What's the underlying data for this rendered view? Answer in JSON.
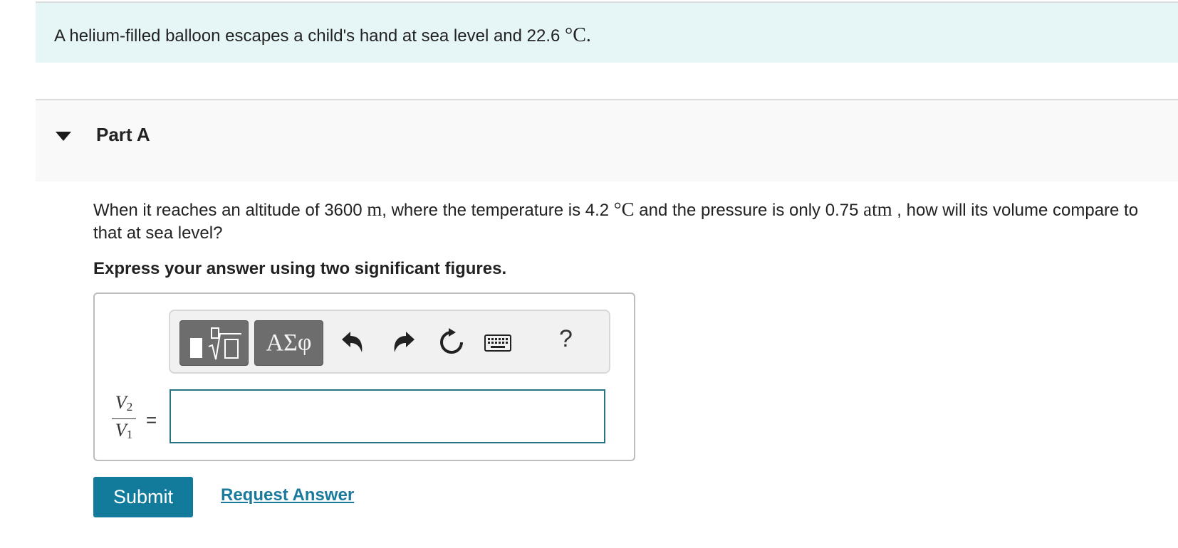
{
  "intro": {
    "text": "A helium-filled balloon escapes a child's hand at sea level and 22.6 ",
    "unit": "°C",
    "end": "."
  },
  "part": {
    "title": "Part A",
    "expanded": true
  },
  "question": {
    "t1": "When it reaches an altitude of 3600 ",
    "u1": "m",
    "t2": ", where the temperature is 4.2 ",
    "u2": "°C",
    "t3": " and the pressure is only 0.75 ",
    "u3": "atm",
    "t4": " , how will its volume compare to that at sea level?"
  },
  "instruction": "Express your answer using two significant figures.",
  "toolbar": {
    "templates_icon": "templates-icon",
    "greek_label": "ΑΣφ",
    "undo_icon": "undo-icon",
    "redo_icon": "redo-icon",
    "reset_icon": "reset-icon",
    "keyboard_icon": "keyboard-icon",
    "help_label": "?"
  },
  "answer": {
    "numerator_var": "V",
    "numerator_sub": "2",
    "denominator_var": "V",
    "denominator_sub": "1",
    "equals": "=",
    "value": ""
  },
  "buttons": {
    "submit": "Submit",
    "request_answer": "Request Answer"
  },
  "colors": {
    "intro_bg": "#e6f6f7",
    "accent": "#127b9c",
    "input_border": "#2a7385"
  }
}
